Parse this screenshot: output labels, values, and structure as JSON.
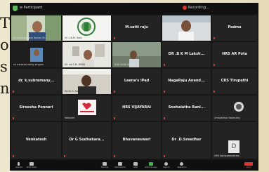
{
  "window": {
    "title": "w Participant",
    "recording_label": "Recording..."
  },
  "background_text": [
    "T",
    "o",
    "s",
    "n"
  ],
  "tiles": [
    {
      "name": "",
      "caption": "Dr.Chandeshwar Kumar Sh..."
    },
    {
      "name": "",
      "caption": "Sri L.B.M. Sant"
    },
    {
      "name": "M.satti raju",
      "caption": ""
    },
    {
      "name": "",
      "caption": ""
    },
    {
      "name": "Padma",
      "caption": ""
    },
    {
      "name": "",
      "caption": "sri naresha reddy singam"
    },
    {
      "name": "",
      "caption": "Sri Lal S.M. RVBH"
    },
    {
      "name": "",
      "caption": "M.B.Girish Kumar"
    },
    {
      "name": "DR .B K M Laksh...",
      "caption": ""
    },
    {
      "name": "HRS AR Pota",
      "caption": ""
    },
    {
      "name": "dr. k.subramany...",
      "caption": ""
    },
    {
      "name": "",
      "caption": "Sh.Dr S. Sarathi..."
    },
    {
      "name": "Leena's iPad",
      "caption": ""
    },
    {
      "name": "NagaRaju Anand...",
      "caption": ""
    },
    {
      "name": "CRS Tirupathi",
      "caption": ""
    },
    {
      "name": "Sireesha Ponneri",
      "caption": ""
    },
    {
      "name": "",
      "caption": "Vakulam"
    },
    {
      "name": "HRS VIJAYARAI",
      "caption": ""
    },
    {
      "name": "Snehalatha Rani...",
      "caption": ""
    },
    {
      "name": "",
      "caption": "Umasekhar Nalaruthy"
    },
    {
      "name": "Venkatesh",
      "caption": ""
    },
    {
      "name": "Dr G Sudhakara...",
      "caption": ""
    },
    {
      "name": "Bhuvaneswari",
      "caption": ""
    },
    {
      "name": "Dr .D.Sreedhar",
      "caption": ""
    },
    {
      "name": "",
      "caption": "HRS Kamasamudram"
    }
  ],
  "avatar_letter": "D",
  "controls": [
    "Unmute",
    "Start Video",
    "Security",
    "Participants",
    "Chat",
    "Share Screen",
    "Record",
    "Reactions",
    "Leave"
  ],
  "colors": {
    "active_border": "#f0d23c",
    "recording": "#e03030",
    "tile_bg": "#232323"
  }
}
